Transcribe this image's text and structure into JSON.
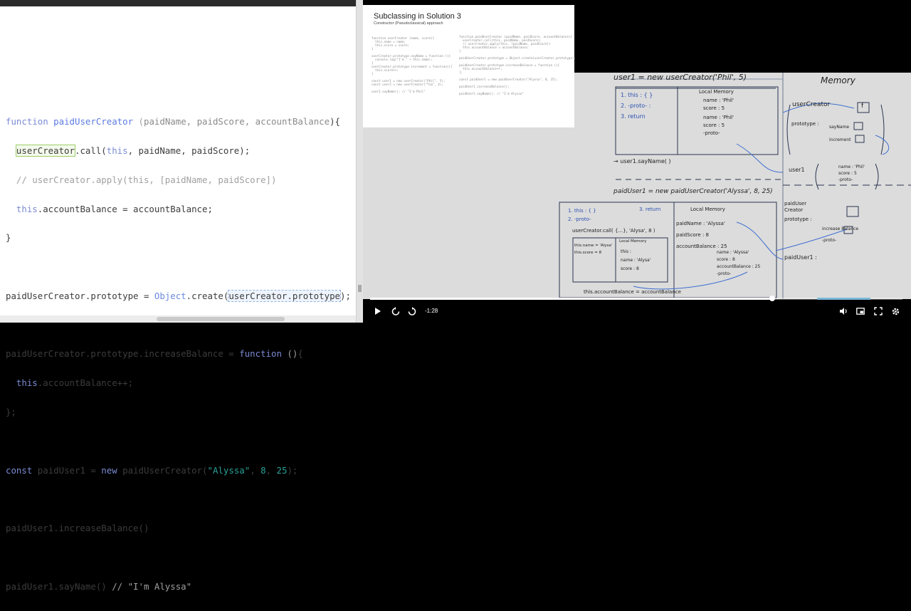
{
  "editor": {
    "lines": [
      "function paidUserCreator (paidName, paidScore, accountBalance){",
      "  userCreator.call(this, paidName, paidScore);",
      "  // userCreator.apply(this, [paidName, paidScore])",
      "  this.accountBalance = accountBalance;",
      "}",
      "",
      "paidUserCreator.prototype = Object.create(userCreator.prototype);",
      "",
      "paidUserCreator.prototype.increaseBalance = function (){",
      "  this.accountBalance++;",
      "};",
      "",
      "const paidUser1 = new paidUserCreator(\"Alyssa\", 8, 25);",
      "",
      "paidUser1.increaseBalance()",
      "",
      "paidUser1.sayName() // \"I'm Alyssa\""
    ]
  },
  "slide": {
    "title": "Subclassing in Solution 3",
    "subtitle": "Constructor (Pseudoclassical) approach",
    "left_code": "function userCreator (name, score){\n  this.name = name;\n  this.score = score;\n}\n\nuserCreator.prototype.sayName = function (){\n  console.log(\"I'm \" + this.name);\n}\nuserCreator.prototype.increment = function(){\n  this.score++;\n}\n\nconst user1 = new userCreator(\"Phil\", 5);\nconst user2 = new userCreator(\"Tim\", 4);\n\nuser1.sayName(); // \"I'm Phil\"",
    "right_code": "function paidUserCreator (paidName, paidScore, accountBalance){\n  userCreator.call(this, paidName, paidScore);\n  // userCreator.apply(this, [paidName, paidScore])\n  this.accountBalance = accountBalance;\n}\n\npaidUserCreator.prototype = Object.create(userCreator.prototype);\n\npaidUserCreator.prototype.increaseBalance = function (){\n  this.accountBalance++;\n};\n\nconst paidUser1 = new paidUserCreator(\"Alyssa\", 8, 25);\n\npaidUser1.increaseBalance();\n\npaidUser1.sayName(); // \"I'm Alyssa\""
  },
  "whiteboard": {
    "user1_line": "user1 = new userCreator('Phil', 5)",
    "memory_label": "Memory",
    "exec_steps": [
      "1. this : { }",
      "2. -proto- :",
      "3. return"
    ],
    "local_memory_label": "Local Memory",
    "local_vars": [
      "name : 'Phil'",
      "score : 5"
    ],
    "this_obj": [
      "name : 'Phil'",
      "score : 5",
      "-proto-"
    ],
    "usercreator_label": "userCreator",
    "f_label": "f",
    "prototype_label": "prototype :",
    "proto_methods": [
      "sayName",
      "increment"
    ],
    "call_line": "→ user1.sayName( )",
    "user1_mem": "user1",
    "user1_obj": [
      "name : 'Phil'",
      "score : 5",
      "-proto-"
    ],
    "paiduser_line": "paidUser1 = new paidUserCreator('Alyssa', 8, 25)",
    "paid_steps": [
      "1. this : { }",
      "2. -proto-",
      "3. return"
    ],
    "paid_local_label": "Local Memory",
    "paid_locals": [
      "paidName : 'Alyssa'",
      "paidScore : 8",
      "accountBalance : 25"
    ],
    "uc_call": "userCreator.call( {...}, 'Alysa', 8 )",
    "inner_locals": [
      "this.name = 'Alysa'",
      "this.score = 8"
    ],
    "inner_local_label": "Local Memory",
    "inner_vals": [
      "this :",
      "name : 'Alysa'",
      "score : 8"
    ],
    "paid_this_obj": [
      "name : 'Alyssa'",
      "score : 8",
      "accountBalance : 25",
      "-proto-"
    ],
    "paid_creator_label": "paidUser Creator",
    "paid_proto_label": "prototype :",
    "paid_proto_items": [
      "increase Balance",
      "-proto-"
    ],
    "paiduser1_mem": "paidUser1 :",
    "bottom_line": "this.accountBalance = accountBalance"
  },
  "player": {
    "time": "-1:28",
    "progress": 0.755,
    "buffered_start": 0.84,
    "buffered_end": 0.94,
    "icons": [
      "play-icon",
      "replay-10-icon",
      "forward-10-icon",
      "volume-icon",
      "pip-icon",
      "fullscreen-icon",
      "settings-icon"
    ]
  }
}
